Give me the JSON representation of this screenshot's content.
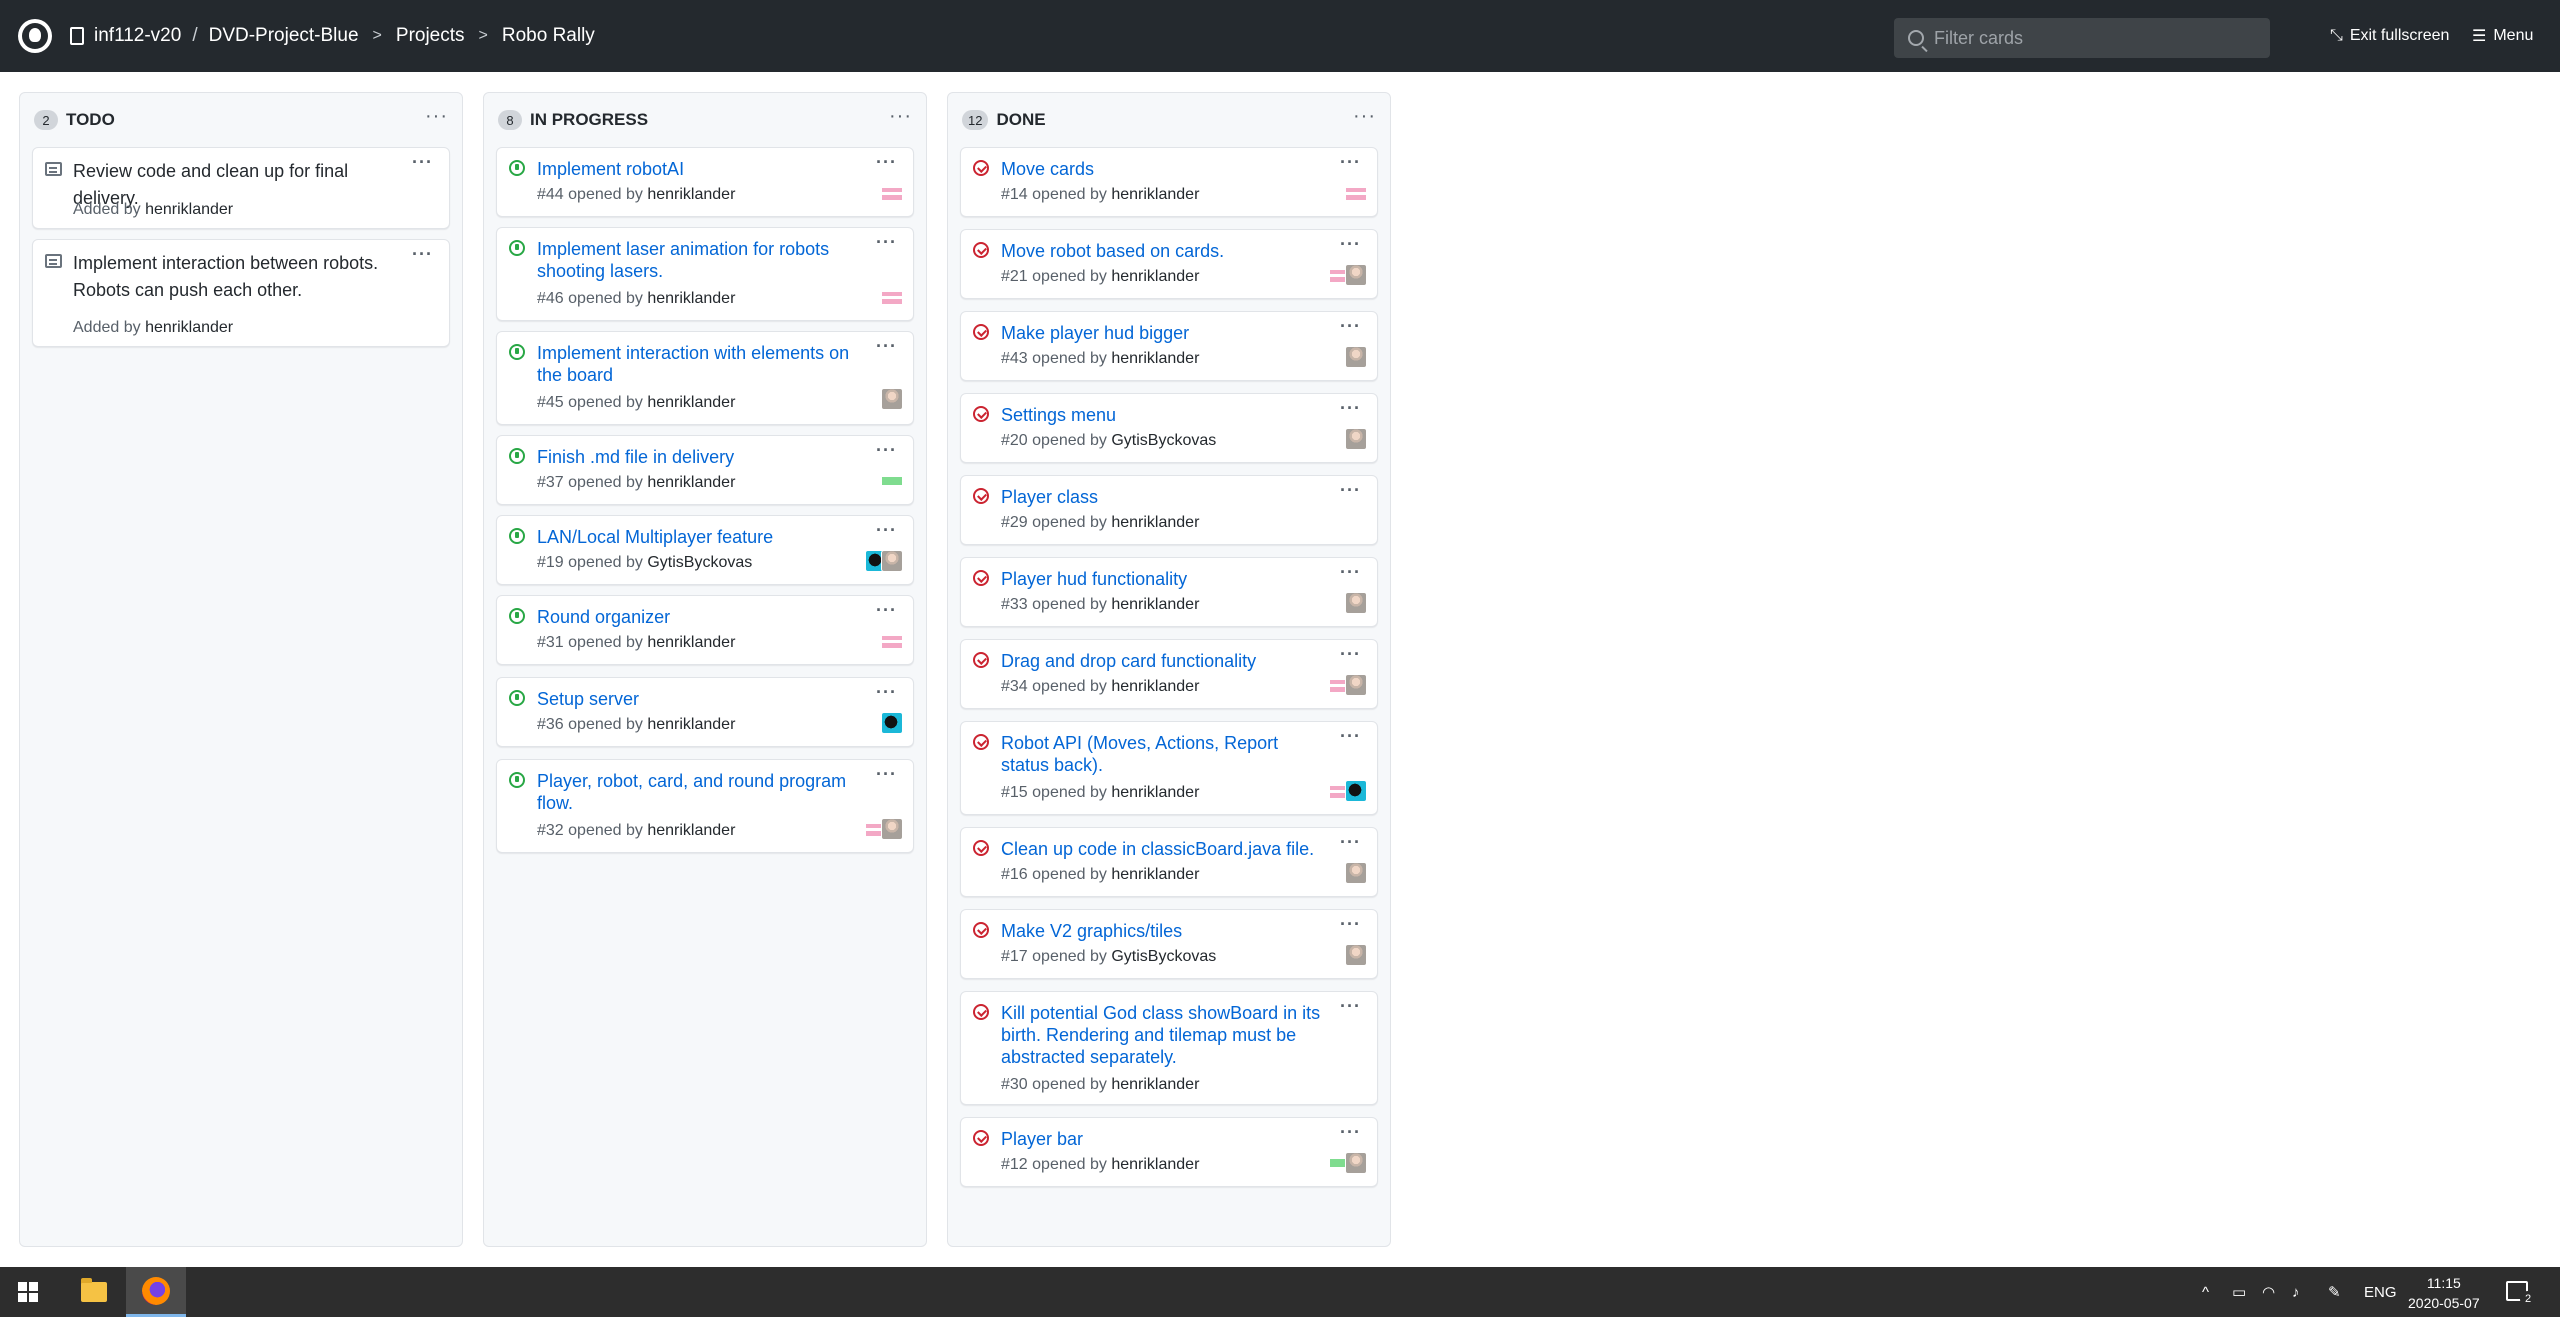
{
  "header": {
    "org": "inf112-v20",
    "repo": "DVD-Project-Blue",
    "section": "Projects",
    "project": "Robo Rally",
    "search_placeholder": "Filter cards",
    "exit_fullscreen": "Exit fullscreen",
    "menu": "Menu"
  },
  "columns": [
    {
      "title": "TODO",
      "count": "2",
      "cards": [
        {
          "text": "Review code and clean up for final delivery.",
          "added_by_label": "Added by",
          "user": "henriklander"
        },
        {
          "text": "Implement interaction between robots. Robots can push each other.",
          "added_by_label": "Added by",
          "user": "henriklander"
        }
      ]
    },
    {
      "title": "IN PROGRESS",
      "count": "8",
      "cards": [
        {
          "title": "Implement robotAI",
          "number": "#44",
          "opened_label": "opened by",
          "user": "henriklander",
          "state": "open"
        },
        {
          "title": "Implement laser animation for robots shooting lasers.",
          "number": "#46",
          "opened_label": "opened by",
          "user": "henriklander",
          "state": "open"
        },
        {
          "title": "Implement interaction with elements on the board",
          "number": "#45",
          "opened_label": "opened by",
          "user": "henriklander",
          "state": "open"
        },
        {
          "title": "Finish .md file in delivery",
          "number": "#37",
          "opened_label": "opened by",
          "user": "henriklander",
          "state": "open"
        },
        {
          "title": "LAN/Local Multiplayer feature",
          "number": "#19",
          "opened_label": "opened by",
          "user": "GytisByckovas",
          "state": "open"
        },
        {
          "title": "Round organizer",
          "number": "#31",
          "opened_label": "opened by",
          "user": "henriklander",
          "state": "open"
        },
        {
          "title": "Setup server",
          "number": "#36",
          "opened_label": "opened by",
          "user": "henriklander",
          "state": "open"
        },
        {
          "title": "Player, robot, card, and round program flow.",
          "number": "#32",
          "opened_label": "opened by",
          "user": "henriklander",
          "state": "open"
        }
      ]
    },
    {
      "title": "DONE",
      "count": "12",
      "cards": [
        {
          "title": "Move cards",
          "number": "#14",
          "opened_label": "opened by",
          "user": "henriklander",
          "state": "closed"
        },
        {
          "title": "Move robot based on cards.",
          "number": "#21",
          "opened_label": "opened by",
          "user": "henriklander",
          "state": "closed"
        },
        {
          "title": "Make player hud bigger",
          "number": "#43",
          "opened_label": "opened by",
          "user": "henriklander",
          "state": "closed"
        },
        {
          "title": "Settings menu",
          "number": "#20",
          "opened_label": "opened by",
          "user": "GytisByckovas",
          "state": "closed"
        },
        {
          "title": "Player class",
          "number": "#29",
          "opened_label": "opened by",
          "user": "henriklander",
          "state": "closed"
        },
        {
          "title": "Player hud functionality",
          "number": "#33",
          "opened_label": "opened by",
          "user": "henriklander",
          "state": "closed"
        },
        {
          "title": "Drag and drop card functionality",
          "number": "#34",
          "opened_label": "opened by",
          "user": "henriklander",
          "state": "closed"
        },
        {
          "title": "Robot API (Moves, Actions, Report status back).",
          "number": "#15",
          "opened_label": "opened by",
          "user": "henriklander",
          "state": "closed"
        },
        {
          "title": "Clean up code in classicBoard.java file.",
          "number": "#16",
          "opened_label": "opened by",
          "user": "henriklander",
          "state": "closed"
        },
        {
          "title": "Make V2 graphics/tiles",
          "number": "#17",
          "opened_label": "opened by",
          "user": "GytisByckovas",
          "state": "closed"
        },
        {
          "title": "Kill potential God class showBoard in its birth. Rendering and tilemap must be abstracted separately.",
          "number": "#30",
          "opened_label": "opened by",
          "user": "henriklander",
          "state": "closed"
        },
        {
          "title": "Player bar",
          "number": "#12",
          "opened_label": "opened by",
          "user": "henriklander",
          "state": "closed"
        }
      ]
    }
  ],
  "taskbar": {
    "language": "ENG",
    "time": "11:15",
    "date": "2020-05-07",
    "notifications": "2"
  },
  "colors": {
    "header_bg": "#24292e",
    "link": "#0366d6",
    "open_state": "#28a745",
    "closed_state": "#cb2431"
  }
}
